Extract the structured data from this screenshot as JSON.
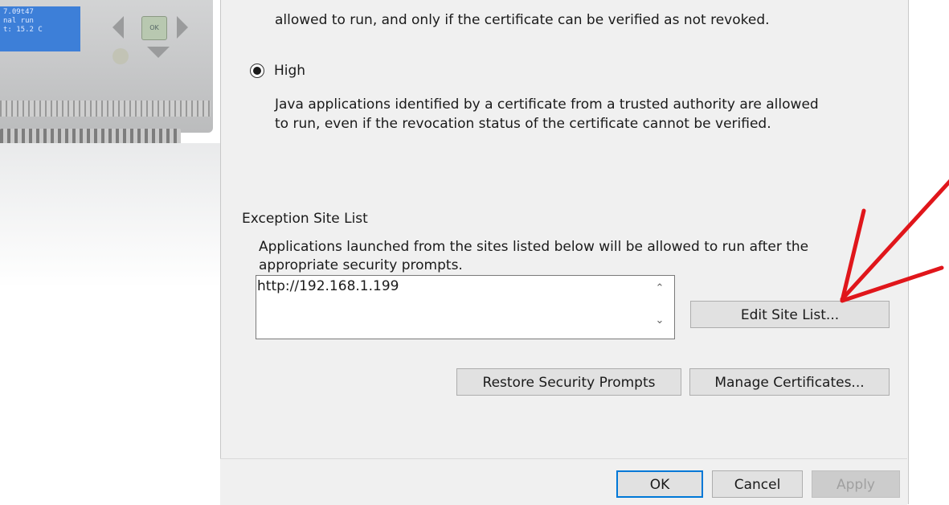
{
  "background_device": {
    "lcd_lines": [
      "7.09t47",
      "nal run",
      "t: 15.2 C"
    ],
    "ok_key_label": "OK"
  },
  "dialog": {
    "top_text": "allowed to run, and only if the certificate can be verified as not revoked.",
    "security_level": {
      "label": "High",
      "selected": true,
      "description_line1": "Java applications identified by a certificate from a trusted authority are allowed",
      "description_line2": "to run, even if the revocation status of the certificate cannot be verified."
    },
    "exception_site_list": {
      "heading": "Exception Site List",
      "description_line1": "Applications launched from the sites listed below will be allowed to run after the",
      "description_line2": "appropriate security prompts.",
      "sites": [
        "http://192.168.1.199"
      ],
      "edit_button": "Edit Site List..."
    },
    "restore_button": "Restore Security Prompts",
    "manage_certificates_button": "Manage Certificates...",
    "footer": {
      "ok": "OK",
      "cancel": "Cancel",
      "apply": "Apply"
    }
  },
  "colors": {
    "dialog_bg": "#f0f0f0",
    "default_button_border": "#0078d7",
    "annotation_arrow": "#e0161b"
  }
}
